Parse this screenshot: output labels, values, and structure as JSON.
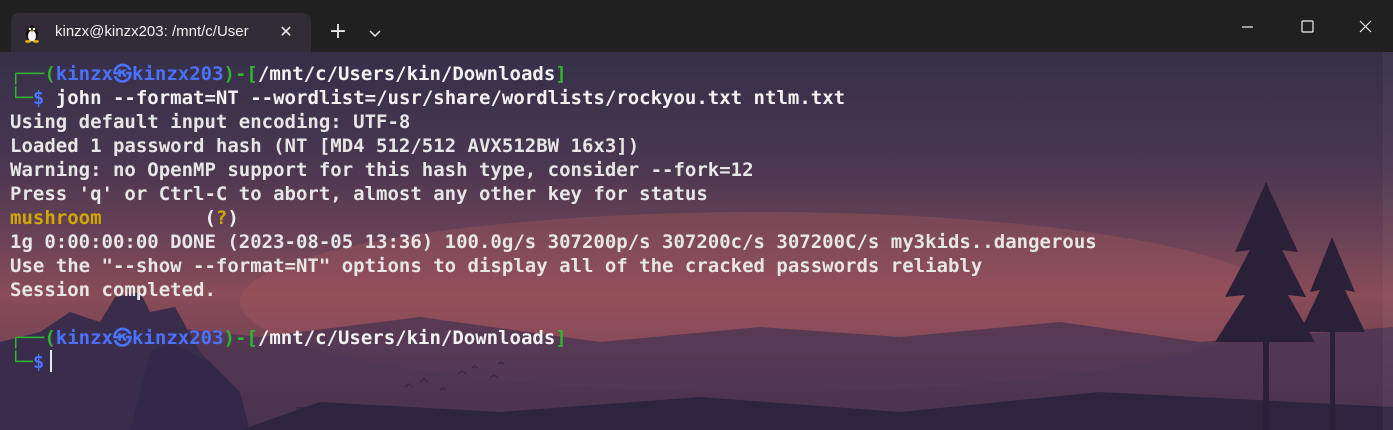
{
  "window": {
    "tab_title": "kinzx@kinzx203: /mnt/c/User",
    "tab_icon": "linux-tux-icon",
    "close_tab_glyph": "✕",
    "new_tab_glyph": "+",
    "dropdown_icon": "chevron-down-icon",
    "controls": [
      "minimize-icon",
      "maximize-icon",
      "close-icon"
    ]
  },
  "terminal": {
    "prompt1": {
      "corner_top": "┌──",
      "open": "(",
      "user": "kinzx",
      "at": "㉿",
      "host": "kinzx203",
      "close": ")",
      "dash": "-",
      "lbracket": "[",
      "path": "/mnt/c/Users/kin/Downloads",
      "rbracket": "]",
      "corner_bottom": "└─",
      "dollar": "$",
      "command": " john --format=NT --wordlist=/usr/share/wordlists/rockyou.txt ntlm.txt"
    },
    "output": [
      "Using default input encoding: UTF-8",
      "Loaded 1 password hash (NT [MD4 512/512 AVX512BW 16x3])",
      "Warning: no OpenMP support for this hash type, consider --fork=12",
      "Press 'q' or Ctrl-C to abort, almost any other key for status"
    ],
    "cracked": {
      "password": "mushroom",
      "spacer": "         ",
      "marker": "(?)"
    },
    "output2": [
      "1g 0:00:00:00 DONE (2023-08-05 13:36) 100.0g/s 307200p/s 307200c/s 307200C/s my3kids..dangerous",
      "Use the \"--show --format=NT\" options to display all of the cracked passwords reliably",
      "Session completed."
    ],
    "prompt2": {
      "corner_top": "┌──",
      "open": "(",
      "user": "kinzx",
      "at": "㉿",
      "host": "kinzx203",
      "close": ")",
      "dash": "-",
      "lbracket": "[",
      "path": "/mnt/c/Users/kin/Downloads",
      "rbracket": "]",
      "corner_bottom": "└─",
      "dollar": "$"
    }
  },
  "colors": {
    "prompt_frame": "#2fb52f",
    "prompt_user_host": "#4a72ff",
    "password": "#d0a800"
  }
}
